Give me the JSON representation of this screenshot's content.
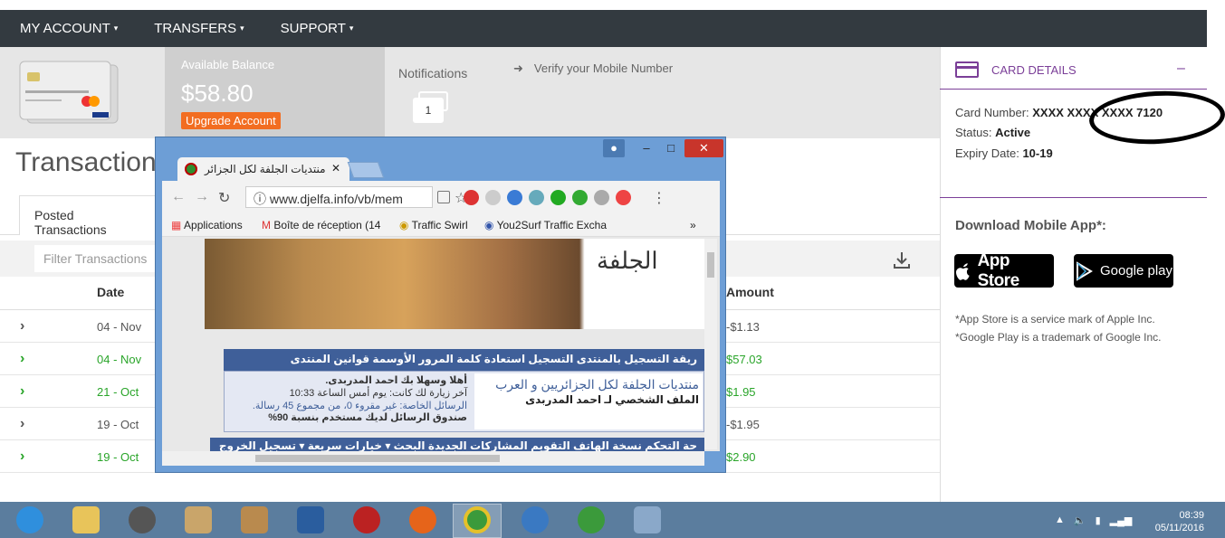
{
  "nav": {
    "items": [
      {
        "label": "MY ACCOUNT"
      },
      {
        "label": "TRANSFERS"
      },
      {
        "label": "SUPPORT"
      }
    ],
    "caret": "▾"
  },
  "account": {
    "balance_label": "Available Balance",
    "balance": "$58.80",
    "upgrade_label": "Upgrade Account",
    "notifications_label": "Notifications",
    "notifications_count": "1",
    "verify_arrow": "➜",
    "verify_text": "Verify your Mobile Number"
  },
  "main": {
    "title": "Transaction",
    "tab_posted": "Posted Transactions",
    "filter_placeholder": "Filter Transactions",
    "col_date": "Date",
    "col_amount": "Amount",
    "rows": [
      {
        "date": "04 - Nov",
        "amount": "-$1.13",
        "color": "#555555",
        "chev": "›"
      },
      {
        "date": "04 - Nov",
        "amount": "$57.03",
        "color": "#2aa52a",
        "chev": "›"
      },
      {
        "date": "21 - Oct",
        "amount": "$1.95",
        "color": "#2aa52a",
        "chev": "›"
      },
      {
        "date": "19 - Oct",
        "amount": "-$1.95",
        "color": "#555555",
        "chev": "›"
      },
      {
        "date": "19 - Oct",
        "amount": "$2.90",
        "color": "#2aa52a",
        "chev": "›"
      }
    ]
  },
  "card_details": {
    "title": "CARD DETAILS",
    "collapse": "–",
    "number_label": "Card Number:",
    "number": "XXXX XXXX XXXX 7120",
    "status_label": "Status:",
    "status": "Active",
    "expiry_label": "Expiry Date:",
    "expiry": "10-19",
    "accent": "#7b3f98"
  },
  "mobile_app": {
    "title": "Download Mobile App*:",
    "appstore": "App Store",
    "googleplay": "Google play",
    "disclaimer1": "*App Store is a service mark of Apple Inc.",
    "disclaimer2": "*Google Play is a trademark of Google Inc."
  },
  "popup": {
    "tab_title": "منتديات الجلفة لكل الجزائر",
    "tab_close": "✕",
    "url": "www.djelfa.info/vb/mem",
    "bookmarks": [
      "Applications",
      "Boîte de réception (14",
      "Traffic Swirl",
      "You2Surf Traffic Excha"
    ],
    "bookmarks_more": "»",
    "forum_nav": "ريقة التسجيل بالمنتدى    التسجيل    استعادة كلمة المرور    الأوسمة    قوانين المنتدى",
    "welcome_line": "أهلا وسهلا بك احمد المدربدى.",
    "last_visit": "آخر زيارة لك كانت: يوم أمس الساعة 10:33",
    "private_msgs": "الرسائل الخاصة: غير مقروء 0، من مجموع 45 رسالة.",
    "inbox_usage": "صندوق الرسائل لديك مستخدم بنسبة 90%",
    "forum_title": "منتديات الجلفة لكل الجزائريين و العرب",
    "profile_line": "الملف الشخصي لـ احمد المدربدى",
    "forum_bar2": "حة التحكم    نسخة الهاتف    التقويم    المشاركات الجديدة    البحث ▾    خيارات سريعة ▾    تسجيل الخروج",
    "banner_logo": "الجلفة"
  },
  "taskbar": {
    "time": "08:39",
    "date": "05/11/2016"
  }
}
